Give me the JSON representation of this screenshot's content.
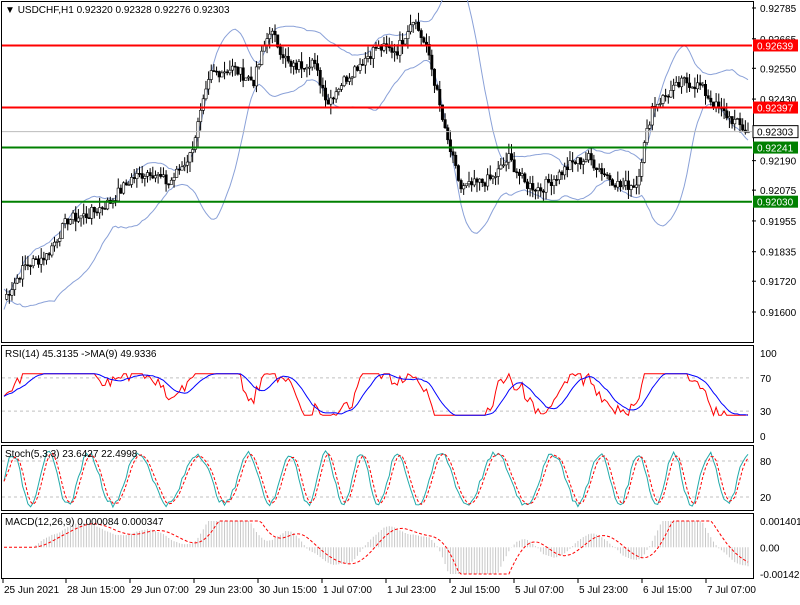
{
  "header": {
    "symbol_label": "USDCHF,H1",
    "ohlc": "0.92320 0.92328 0.92276 0.92303"
  },
  "price_axis": {
    "ticks": [
      "0.92785",
      "0.92665",
      "0.92550",
      "0.92430",
      "0.92190",
      "0.92075",
      "0.91955",
      "0.91835",
      "0.91600",
      "0.91720"
    ],
    "tick_values": [
      0.92785,
      0.92665,
      0.9255,
      0.9243,
      0.9219,
      0.92075,
      0.91955,
      0.91835,
      0.916,
      0.9172
    ],
    "range": [
      0.916,
      0.92785
    ]
  },
  "levels": [
    {
      "value": 0.92639,
      "label": "0.92639",
      "color": "#ff0000"
    },
    {
      "value": 0.92397,
      "label": "0.92397",
      "color": "#ff0000"
    },
    {
      "value": 0.92303,
      "label": "0.92303",
      "color": "#000000",
      "current": true
    },
    {
      "value": 0.92241,
      "label": "0.92241",
      "color": "#008000"
    },
    {
      "value": 0.9203,
      "label": "0.92030",
      "color": "#008000"
    }
  ],
  "time_axis": [
    "25 Jun 2021",
    "28 Jun 15:00",
    "29 Jun 07:00",
    "29 Jun 23:00",
    "30 Jun 15:00",
    "1 Jul 07:00",
    "1 Jul 23:00",
    "2 Jul 15:00",
    "5 Jul 07:00",
    "5 Jul 23:00",
    "6 Jul 15:00",
    "7 Jul 07:00"
  ],
  "rsi": {
    "label": "RSI(14) 45.3135  ->MA(9) 49.9336",
    "ticks": [
      "100",
      "70",
      "30",
      "0"
    ],
    "levels": [
      70,
      30
    ]
  },
  "stoch": {
    "label": "Stoch(5,3,3) 23.6427 22.4998",
    "ticks": [
      "80",
      "20"
    ],
    "levels": [
      80,
      20
    ]
  },
  "macd": {
    "label": "MACD(12,26,9) 0.000084 0.000347",
    "ticks": [
      "0.001401",
      "0.00",
      "-0.001423"
    ],
    "range": [
      -0.001423,
      0.001401
    ]
  },
  "colors": {
    "bull": "#000000",
    "bear": "#7a1515",
    "band": "#8aa1d8",
    "rsi_line": "#ff0000",
    "rsi_ma": "#0000ff",
    "stoch_main": "#22aaaa",
    "stoch_signal": "#ff0000",
    "macd_hist": "#c8c8c8",
    "macd_signal": "#ff0000",
    "grid": "#c0c0c0"
  },
  "chart_data": {
    "type": "candlestick",
    "symbol": "USDCHF",
    "timeframe": "H1",
    "title": "USDCHF,H1",
    "ylim": [
      0.916,
      0.92785
    ],
    "close_path": [
      [
        0,
        0.9165
      ],
      [
        8,
        0.9178
      ],
      [
        16,
        0.9182
      ],
      [
        24,
        0.9196
      ],
      [
        32,
        0.9198
      ],
      [
        40,
        0.9203
      ],
      [
        48,
        0.9212
      ],
      [
        55,
        0.9215
      ],
      [
        62,
        0.921
      ],
      [
        70,
        0.9221
      ],
      [
        78,
        0.9253
      ],
      [
        86,
        0.9255
      ],
      [
        94,
        0.925
      ],
      [
        100,
        0.927
      ],
      [
        108,
        0.9255
      ],
      [
        116,
        0.9258
      ],
      [
        122,
        0.9242
      ],
      [
        126,
        0.9248
      ],
      [
        132,
        0.9255
      ],
      [
        140,
        0.9263
      ],
      [
        148,
        0.9262
      ],
      [
        154,
        0.9275
      ],
      [
        160,
        0.926
      ],
      [
        166,
        0.923
      ],
      [
        172,
        0.9208
      ],
      [
        178,
        0.921
      ],
      [
        184,
        0.9212
      ],
      [
        190,
        0.922
      ],
      [
        196,
        0.921
      ],
      [
        202,
        0.9208
      ],
      [
        208,
        0.9213
      ],
      [
        214,
        0.9218
      ],
      [
        220,
        0.922
      ],
      [
        226,
        0.9214
      ],
      [
        232,
        0.9209
      ],
      [
        238,
        0.921
      ],
      [
        244,
        0.924
      ],
      [
        250,
        0.9245
      ],
      [
        256,
        0.925
      ],
      [
        262,
        0.9248
      ],
      [
        268,
        0.924
      ],
      [
        274,
        0.9235
      ],
      [
        280,
        0.923
      ]
    ]
  }
}
